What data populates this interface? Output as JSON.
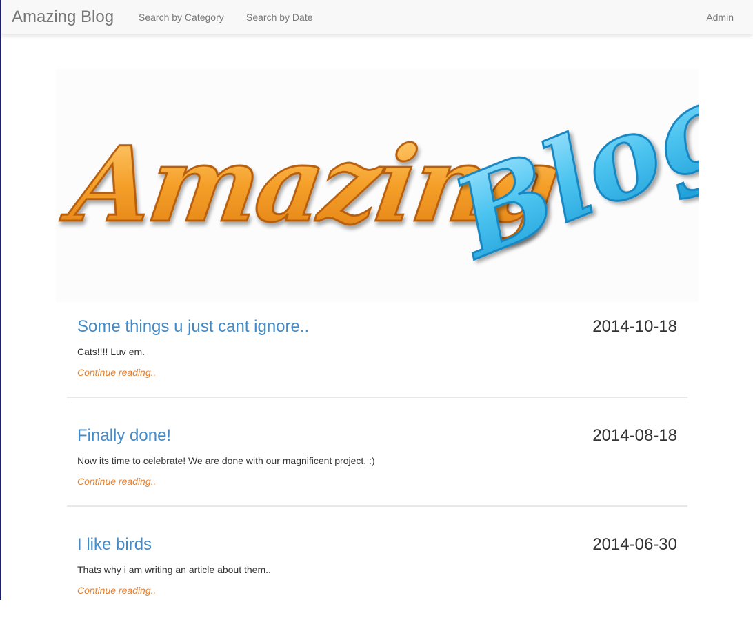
{
  "navbar": {
    "brand": "Amazing Blog",
    "links": [
      "Search by Category",
      "Search by Date"
    ],
    "admin": "Admin"
  },
  "banner": {
    "logo_text_1": "Amazing",
    "logo_text_2": "Blog",
    "colors": {
      "orange": "#f5a02a",
      "blue": "#4cc4f0"
    }
  },
  "posts": [
    {
      "title": "Some things u just cant ignore..",
      "date": "2014-10-18",
      "excerpt": "Cats!!!! Luv em.",
      "more": "Continue reading.."
    },
    {
      "title": "Finally done!",
      "date": "2014-08-18",
      "excerpt": "Now its time to celebrate! We are done with our magnificent project. :)",
      "more": "Continue reading.."
    },
    {
      "title": "I like birds",
      "date": "2014-06-30",
      "excerpt": "Thats why i am writing an article about them..",
      "more": "Continue reading.."
    }
  ],
  "colors": {
    "link": "#428bca",
    "accent": "#e8822e",
    "navbar_bg": "#f8f8f8"
  }
}
